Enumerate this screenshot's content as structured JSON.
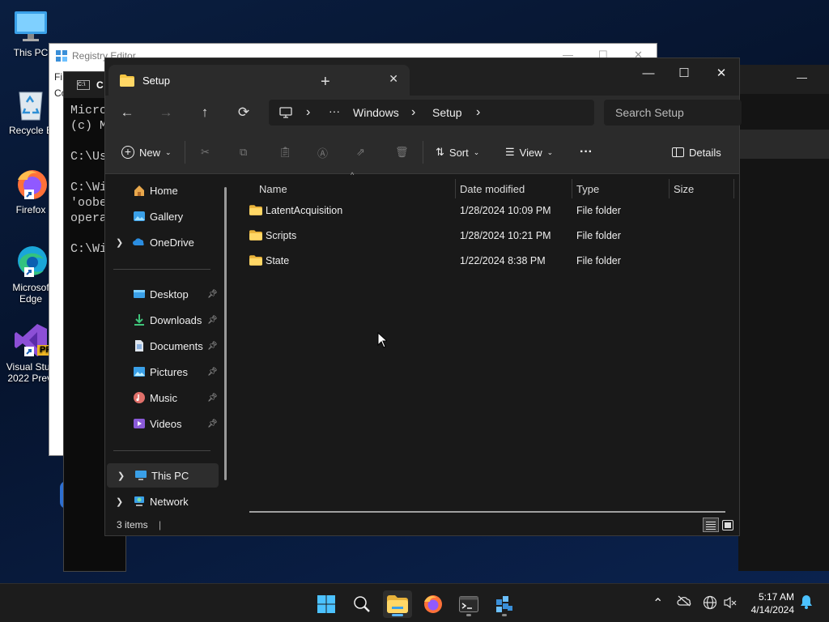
{
  "desktop": {
    "icons": [
      {
        "label": "This PC"
      },
      {
        "label": "Recycle B"
      },
      {
        "label": "Firefox"
      },
      {
        "label_line1": "Microsof",
        "label_line2": "Edge"
      },
      {
        "label_line1": "Visual Stud",
        "label_line2": "2022 Previ",
        "badge": "PRE"
      }
    ]
  },
  "registry": {
    "title": "Registry Editor",
    "menu_first": "Fi",
    "addr_first": "Co"
  },
  "cmd": {
    "tab_label": "C",
    "lines": "Micro\n(c) M\n\nC:\\Us\n\nC:\\Wi\n'oobe\nopera\n\nC:\\Wi"
  },
  "explorer": {
    "tab_title": "Setup",
    "tab_close": "✕",
    "new_tab": "+",
    "win_minimize": "—",
    "win_maximize": "☐",
    "win_close": "✕",
    "nav": {
      "back": "←",
      "forward": "→",
      "up": "↑",
      "refresh": "⟳"
    },
    "breadcrumb": {
      "more": "···",
      "items": [
        "Windows",
        "Setup"
      ],
      "sep": "›"
    },
    "search_placeholder": "Search Setup",
    "toolbar": {
      "new_label": "New",
      "sort_label": "Sort",
      "view_label": "View",
      "more": "···",
      "details_label": "Details"
    },
    "sidebar": {
      "home": "Home",
      "gallery": "Gallery",
      "onedrive": "OneDrive",
      "desktop": "Desktop",
      "downloads": "Downloads",
      "documents": "Documents",
      "pictures": "Pictures",
      "music": "Music",
      "videos": "Videos",
      "this_pc": "This PC",
      "network": "Network"
    },
    "columns": {
      "name": "Name",
      "date": "Date modified",
      "type": "Type",
      "size": "Size"
    },
    "files": [
      {
        "name": "LatentAcquisition",
        "date": "1/28/2024 10:09 PM",
        "type": "File folder"
      },
      {
        "name": "Scripts",
        "date": "1/28/2024 10:21 PM",
        "type": "File folder"
      },
      {
        "name": "State",
        "date": "1/22/2024 8:38 PM",
        "type": "File folder"
      }
    ],
    "status": "3 items"
  },
  "taskbar": {
    "clock_time": "5:17 AM",
    "clock_date": "4/14/2024",
    "accent": "#5ab4f5"
  },
  "colors": {
    "folder": "#f4c542",
    "accent": "#5ab4f5",
    "explorer_bg": "#191919"
  }
}
